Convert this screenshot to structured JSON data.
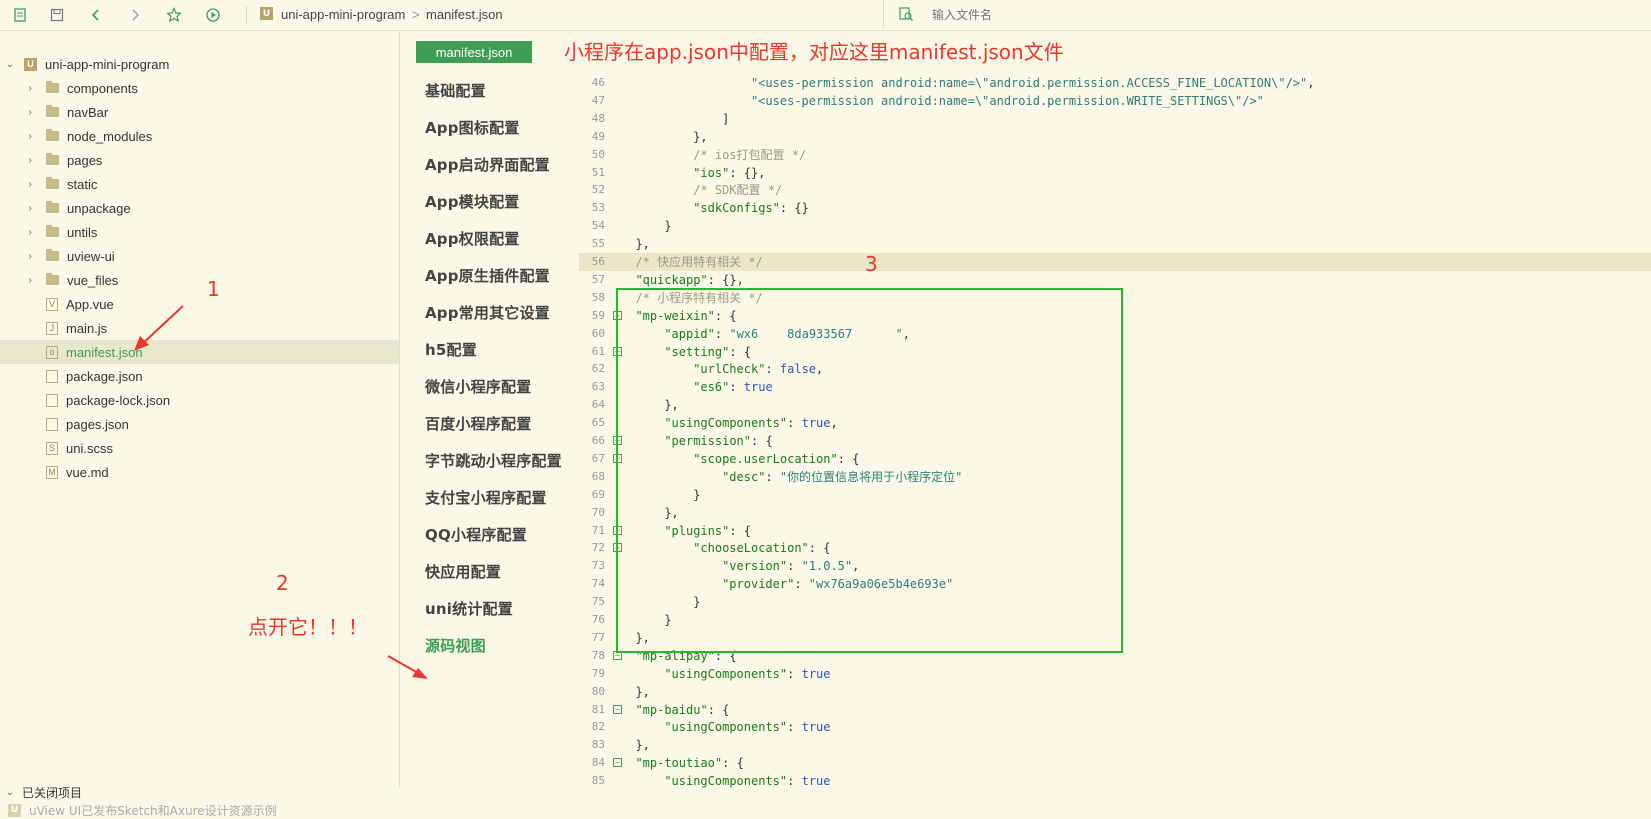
{
  "toolbar": {
    "icons": [
      "new-file-icon",
      "save-icon",
      "back-icon",
      "forward-icon",
      "star-icon",
      "run-icon"
    ],
    "breadcrumb": [
      "uni-app-mini-program",
      "manifest.json"
    ],
    "breadcrumb_sep": ">",
    "project_logo": "U",
    "search_placeholder": "输入文件名"
  },
  "explorer": {
    "root": "uni-app-mini-program",
    "items": [
      {
        "label": "components",
        "type": "folder"
      },
      {
        "label": "navBar",
        "type": "folder"
      },
      {
        "label": "node_modules",
        "type": "folder"
      },
      {
        "label": "pages",
        "type": "folder"
      },
      {
        "label": "static",
        "type": "folder"
      },
      {
        "label": "unpackage",
        "type": "folder"
      },
      {
        "label": "untils",
        "type": "folder"
      },
      {
        "label": "uview-ui",
        "type": "folder"
      },
      {
        "label": "vue_files",
        "type": "folder"
      },
      {
        "label": "App.vue",
        "type": "file",
        "glyph": "V"
      },
      {
        "label": "main.js",
        "type": "file",
        "glyph": "J"
      },
      {
        "label": "manifest.json",
        "type": "file",
        "glyph": "o",
        "selected": true
      },
      {
        "label": "package.json",
        "type": "file",
        "glyph": ""
      },
      {
        "label": "package-lock.json",
        "type": "file",
        "glyph": ""
      },
      {
        "label": "pages.json",
        "type": "file",
        "glyph": ""
      },
      {
        "label": "uni.scss",
        "type": "file",
        "glyph": "S"
      },
      {
        "label": "vue.md",
        "type": "file",
        "glyph": "M"
      }
    ],
    "closed_projects": "已关闭项目",
    "status": "uView UI已发布Sketch和Axure设计资源示例"
  },
  "config_menu": {
    "tab": "manifest.json",
    "items": [
      "基础配置",
      "App图标配置",
      "App启动界面配置",
      "App模块配置",
      "App权限配置",
      "App原生插件配置",
      "App常用其它设置",
      "h5配置",
      "微信小程序配置",
      "百度小程序配置",
      "字节跳动小程序配置",
      "支付宝小程序配置",
      "QQ小程序配置",
      "快应用配置",
      "uni统计配置",
      "源码视图"
    ],
    "active_index": 15
  },
  "editor": {
    "lines": [
      {
        "n": "46",
        "indent": 18,
        "tokens": [
          [
            "str",
            "\"<uses-permission android:name=\\\"android.permission.ACCESS_FINE_LOCATION\\\"/>\""
          ],
          [
            "pun",
            ","
          ]
        ]
      },
      {
        "n": "47",
        "indent": 18,
        "tokens": [
          [
            "str",
            "\"<uses-permission android:name=\\\"android.permission.WRITE_SETTINGS\\\"/>\""
          ]
        ]
      },
      {
        "n": "48",
        "indent": 14,
        "tokens": [
          [
            "pun",
            "]"
          ]
        ]
      },
      {
        "n": "49",
        "indent": 10,
        "tokens": [
          [
            "pun",
            "},"
          ]
        ]
      },
      {
        "n": "50",
        "indent": 10,
        "tokens": [
          [
            "cmt",
            "/* ios打包配置 */"
          ]
        ]
      },
      {
        "n": "51",
        "indent": 10,
        "tokens": [
          [
            "key",
            "\"ios\""
          ],
          [
            "pun",
            ": {},"
          ]
        ]
      },
      {
        "n": "52",
        "indent": 10,
        "tokens": [
          [
            "cmt",
            "/* SDK配置 */"
          ]
        ]
      },
      {
        "n": "53",
        "indent": 10,
        "tokens": [
          [
            "key",
            "\"sdkConfigs\""
          ],
          [
            "pun",
            ": {}"
          ]
        ]
      },
      {
        "n": "54",
        "indent": 6,
        "tokens": [
          [
            "pun",
            "}"
          ]
        ]
      },
      {
        "n": "55",
        "indent": 2,
        "tokens": [
          [
            "pun",
            "},"
          ]
        ]
      },
      {
        "n": "56",
        "indent": 2,
        "hl": true,
        "tokens": [
          [
            "cmt",
            "/* 快应用特有相关 */"
          ]
        ]
      },
      {
        "n": "57",
        "indent": 2,
        "tokens": [
          [
            "key",
            "\"quickapp\""
          ],
          [
            "pun",
            ": {},"
          ]
        ]
      },
      {
        "n": "58",
        "indent": 2,
        "tokens": [
          [
            "cmt",
            "/* 小程序特有相关 */"
          ]
        ]
      },
      {
        "n": "59",
        "indent": 2,
        "fold": true,
        "tokens": [
          [
            "key",
            "\"mp-weixin\""
          ],
          [
            "pun",
            ": {"
          ]
        ]
      },
      {
        "n": "60",
        "indent": 6,
        "tokens": [
          [
            "key",
            "\"appid\""
          ],
          [
            "pun",
            ": "
          ],
          [
            "str",
            "\"wx6    8da933567      \""
          ],
          [
            "pun",
            ","
          ]
        ]
      },
      {
        "n": "61",
        "indent": 6,
        "fold": true,
        "tokens": [
          [
            "key",
            "\"setting\""
          ],
          [
            "pun",
            ": {"
          ]
        ]
      },
      {
        "n": "62",
        "indent": 10,
        "tokens": [
          [
            "key",
            "\"urlCheck\""
          ],
          [
            "pun",
            ": "
          ],
          [
            "lit",
            "false"
          ],
          [
            "pun",
            ","
          ]
        ]
      },
      {
        "n": "63",
        "indent": 10,
        "tokens": [
          [
            "key",
            "\"es6\""
          ],
          [
            "pun",
            ": "
          ],
          [
            "lit",
            "true"
          ]
        ]
      },
      {
        "n": "64",
        "indent": 6,
        "tokens": [
          [
            "pun",
            "},"
          ]
        ]
      },
      {
        "n": "65",
        "indent": 6,
        "tokens": [
          [
            "key",
            "\"usingComponents\""
          ],
          [
            "pun",
            ": "
          ],
          [
            "lit",
            "true"
          ],
          [
            "pun",
            ","
          ]
        ]
      },
      {
        "n": "66",
        "indent": 6,
        "fold": true,
        "tokens": [
          [
            "key",
            "\"permission\""
          ],
          [
            "pun",
            ": {"
          ]
        ]
      },
      {
        "n": "67",
        "indent": 10,
        "fold": true,
        "tokens": [
          [
            "key",
            "\"scope.userLocation\""
          ],
          [
            "pun",
            ": {"
          ]
        ]
      },
      {
        "n": "68",
        "indent": 14,
        "tokens": [
          [
            "key",
            "\"desc\""
          ],
          [
            "pun",
            ": "
          ],
          [
            "str",
            "\"你的位置信息将用于小程序定位\""
          ]
        ]
      },
      {
        "n": "69",
        "indent": 10,
        "tokens": [
          [
            "pun",
            "}"
          ]
        ]
      },
      {
        "n": "70",
        "indent": 6,
        "tokens": [
          [
            "pun",
            "},"
          ]
        ]
      },
      {
        "n": "71",
        "indent": 6,
        "fold": true,
        "tokens": [
          [
            "key",
            "\"plugins\""
          ],
          [
            "pun",
            ": {"
          ]
        ]
      },
      {
        "n": "72",
        "indent": 10,
        "fold": true,
        "tokens": [
          [
            "key",
            "\"chooseLocation\""
          ],
          [
            "pun",
            ": {"
          ]
        ]
      },
      {
        "n": "73",
        "indent": 14,
        "tokens": [
          [
            "key",
            "\"version\""
          ],
          [
            "pun",
            ": "
          ],
          [
            "str",
            "\"1.0.5\""
          ],
          [
            "pun",
            ","
          ]
        ]
      },
      {
        "n": "74",
        "indent": 14,
        "tokens": [
          [
            "key",
            "\"provider\""
          ],
          [
            "pun",
            ": "
          ],
          [
            "str",
            "\"wx76a9a06e5b4e693e\""
          ]
        ]
      },
      {
        "n": "75",
        "indent": 10,
        "tokens": [
          [
            "pun",
            "}"
          ]
        ]
      },
      {
        "n": "76",
        "indent": 6,
        "tokens": [
          [
            "pun",
            "}"
          ]
        ]
      },
      {
        "n": "77",
        "indent": 2,
        "tokens": [
          [
            "pun",
            "},"
          ]
        ]
      },
      {
        "n": "78",
        "indent": 2,
        "fold": true,
        "tokens": [
          [
            "key",
            "\"mp-alipay\""
          ],
          [
            "pun",
            ": {"
          ]
        ]
      },
      {
        "n": "79",
        "indent": 6,
        "tokens": [
          [
            "key",
            "\"usingComponents\""
          ],
          [
            "pun",
            ": "
          ],
          [
            "lit",
            "true"
          ]
        ]
      },
      {
        "n": "80",
        "indent": 2,
        "tokens": [
          [
            "pun",
            "},"
          ]
        ]
      },
      {
        "n": "81",
        "indent": 2,
        "fold": true,
        "tokens": [
          [
            "key",
            "\"mp-baidu\""
          ],
          [
            "pun",
            ": {"
          ]
        ]
      },
      {
        "n": "82",
        "indent": 6,
        "tokens": [
          [
            "key",
            "\"usingComponents\""
          ],
          [
            "pun",
            ": "
          ],
          [
            "lit",
            "true"
          ]
        ]
      },
      {
        "n": "83",
        "indent": 2,
        "tokens": [
          [
            "pun",
            "},"
          ]
        ]
      },
      {
        "n": "84",
        "indent": 2,
        "fold": true,
        "tokens": [
          [
            "key",
            "\"mp-toutiao\""
          ],
          [
            "pun",
            ": {"
          ]
        ]
      },
      {
        "n": "85",
        "indent": 6,
        "tokens": [
          [
            "key",
            "\"usingComponents\""
          ],
          [
            "pun",
            ": "
          ],
          [
            "lit",
            "true"
          ]
        ]
      }
    ]
  },
  "annotations": {
    "title": "小程序在app.json中配置，对应这里manifest.json文件",
    "one": "1",
    "two": "2",
    "three": "3",
    "click": "点开它！！！"
  },
  "colors": {
    "accent": "#3d9e55",
    "annotation": "#e8372c",
    "box": "#2db52d",
    "background": "#fbf8e7"
  }
}
